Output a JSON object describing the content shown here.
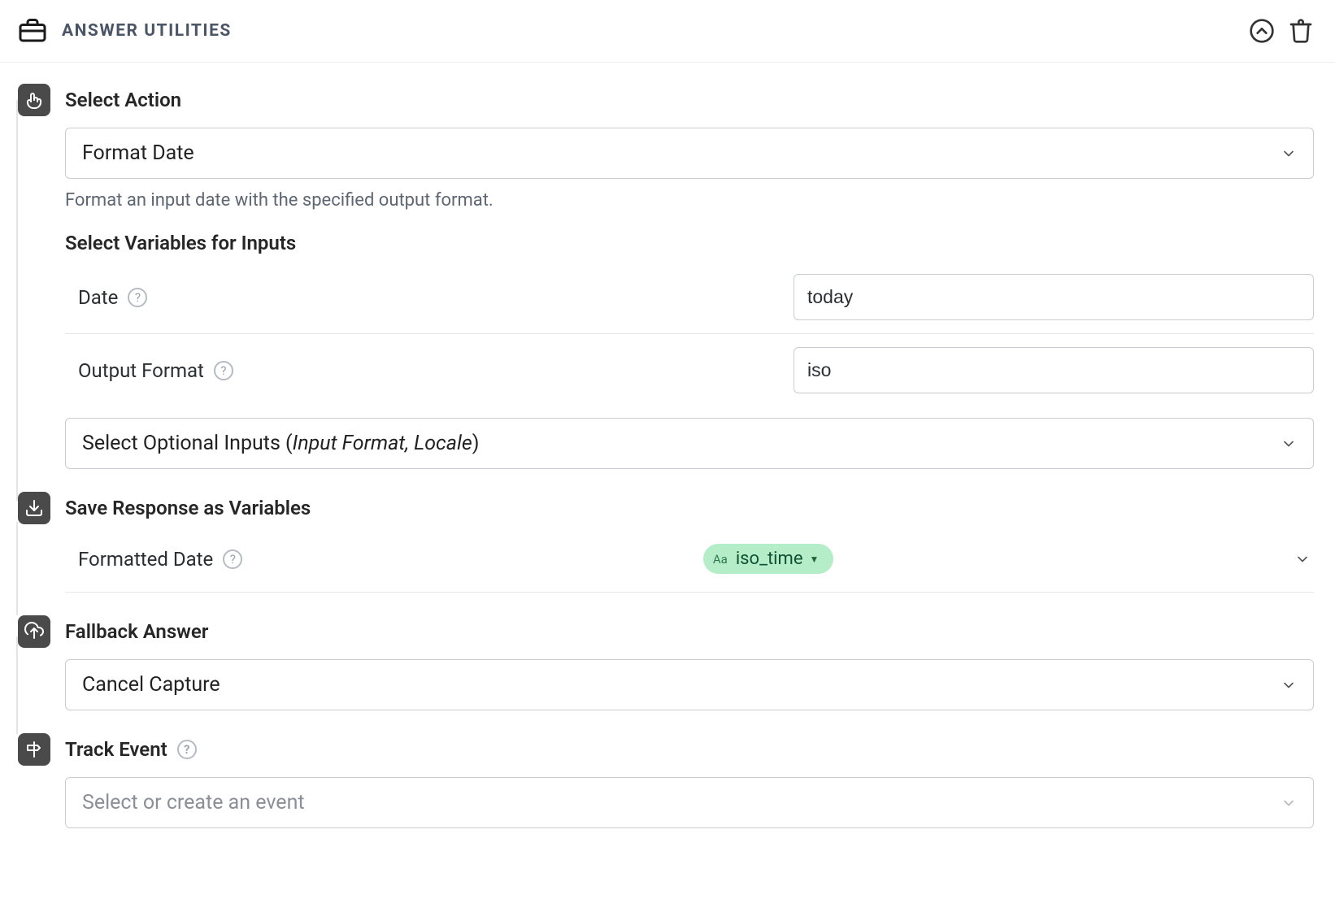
{
  "header": {
    "title": "ANSWER UTILITIES"
  },
  "action": {
    "label": "Select Action",
    "selected": "Format Date",
    "description": "Format an input date with the specified output format."
  },
  "inputs": {
    "heading": "Select Variables for Inputs",
    "rows": [
      {
        "label": "Date",
        "value": "today"
      },
      {
        "label": "Output Format",
        "value": "iso"
      }
    ],
    "optional_prefix": "Select Optional Inputs (",
    "optional_italic": "Input Format, Locale",
    "optional_suffix": ")"
  },
  "saveVars": {
    "label": "Save Response as Variables",
    "rows": [
      {
        "label": "Formatted Date",
        "chip": "iso_time"
      }
    ]
  },
  "fallback": {
    "label": "Fallback Answer",
    "selected": "Cancel Capture"
  },
  "trackEvent": {
    "label": "Track Event",
    "placeholder": "Select or create an event"
  }
}
